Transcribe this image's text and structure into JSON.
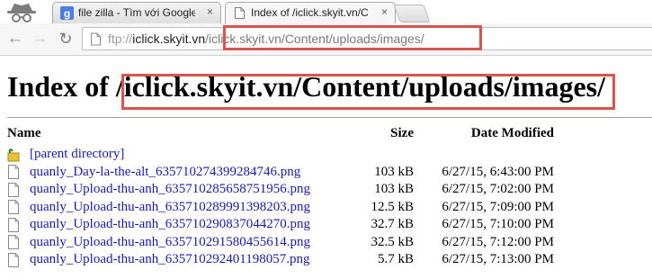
{
  "tabs": [
    {
      "title": "file zilla - Tìm với Google",
      "close": "×",
      "favicon": "google-g-icon"
    },
    {
      "title": "Index of /iclick.skyit.vn/Co",
      "close": "×",
      "favicon": "page-icon"
    }
  ],
  "toolbar": {
    "back": "←",
    "forward": "→",
    "reload": "↻",
    "url_scheme": "ftp://",
    "url_host": "iclick.skyit.vn",
    "url_path": "/iclick.skyit.vn/Content/uploads/images/"
  },
  "page": {
    "heading": "Index of /iclick.skyit.vn/Content/uploads/images/",
    "columns": {
      "name": "Name",
      "size": "Size",
      "date": "Date Modified"
    },
    "parent": "[parent directory]",
    "files": [
      {
        "name": "quanly_Day-la-the-alt_635710274399284746.png",
        "size": "103 kB",
        "date": "6/27/15, 6:43:00 PM"
      },
      {
        "name": "quanly_Upload-thu-anh_635710285658751956.png",
        "size": "103 kB",
        "date": "6/27/15, 7:02:00 PM"
      },
      {
        "name": "quanly_Upload-thu-anh_635710289991398203.png",
        "size": "12.5 kB",
        "date": "6/27/15, 7:09:00 PM"
      },
      {
        "name": "quanly_Upload-thu-anh_635710290837044270.png",
        "size": "32.7 kB",
        "date": "6/27/15, 7:10:00 PM"
      },
      {
        "name": "quanly_Upload-thu-anh_635710291580455614.png",
        "size": "32.5 kB",
        "date": "6/27/15, 7:12:00 PM"
      },
      {
        "name": "quanly_Upload-thu-anh_635710292401198057.png",
        "size": "5.7 kB",
        "date": "6/27/15, 7:13:00 PM"
      }
    ]
  },
  "colors": {
    "highlight": "#d9534f",
    "link": "#1a1aa6"
  }
}
